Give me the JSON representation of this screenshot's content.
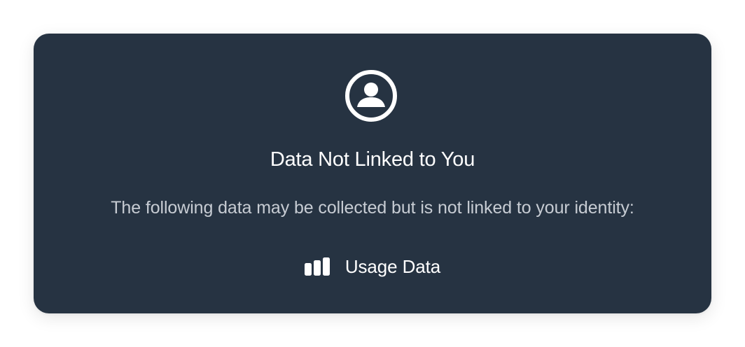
{
  "card": {
    "icon": "person-circle-icon",
    "title": "Data Not Linked to You",
    "description": "The following data may be collected but is not linked to your identity:",
    "items": [
      {
        "icon": "usage-data-icon",
        "label": "Usage Data"
      }
    ]
  },
  "colors": {
    "card_background": "#263342",
    "text_primary": "#ffffff",
    "text_secondary": "#c7ccd3"
  }
}
